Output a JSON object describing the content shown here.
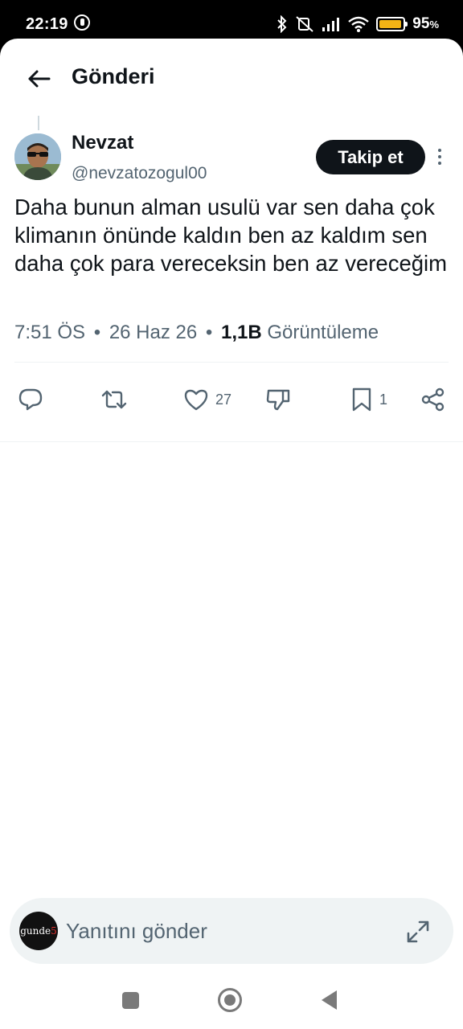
{
  "status_bar": {
    "time": "22:19",
    "battery_percent_label": "95",
    "battery_percent_suffix": "%",
    "battery_level": 0.95,
    "battery_color": "#f3b415"
  },
  "header": {
    "title": "Gönderi",
    "back_icon": "arrow-left-icon"
  },
  "tweet": {
    "author_name": "Nevzat",
    "author_handle": "@nevzatozogul00",
    "follow_label": "Takip et",
    "text": "Daha bunun alman usulü var sen daha çok klimanın önünde kaldın ben az kaldım sen daha çok para vereceksin ben az vereceğim",
    "time": "7:51 ÖS",
    "separator": "•",
    "date": "26 Haz 26",
    "views_count": "1,1B",
    "views_label": "Görüntüleme"
  },
  "actions": {
    "reply_icon": "reply-icon",
    "retweet_icon": "retweet-icon",
    "like_icon": "heart-icon",
    "like_count": "27",
    "dislike_icon": "thumbs-down-icon",
    "bookmark_icon": "bookmark-icon",
    "bookmark_count": "1",
    "share_icon": "share-icon"
  },
  "reply_bar": {
    "placeholder": "Yanıtını gönder",
    "avatar_text_main": "gunde",
    "avatar_text_accent": "5",
    "expand_icon": "expand-icon"
  },
  "colors": {
    "primary_text": "#0f1419",
    "secondary_text": "#536471",
    "divider": "#eff3f4",
    "button_bg": "#0f1419"
  }
}
